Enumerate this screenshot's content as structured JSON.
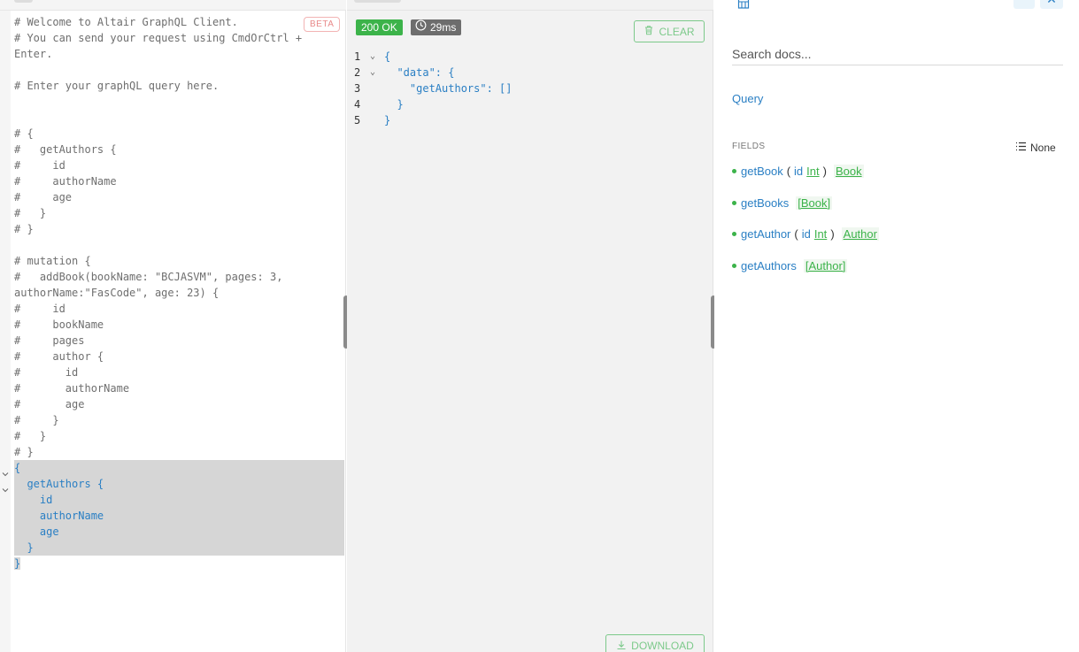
{
  "query_editor": {
    "beta_label": "BETA",
    "lines": [
      "# Welcome to Altair GraphQL Client.",
      "# You can send your request using CmdOrCtrl +",
      "Enter.",
      "",
      "# Enter your graphQL query here.",
      "",
      "",
      "# {",
      "#   getAuthors {",
      "#     id",
      "#     authorName",
      "#     age",
      "#   }",
      "# }",
      "",
      "# mutation {",
      "#   addBook(bookName: \"BCJASVM\", pages: 3,",
      "authorName:\"FasCode\", age: 23) {",
      "#     id",
      "#     bookName",
      "#     pages",
      "#     author {",
      "#       id",
      "#       authorName",
      "#       age",
      "#     }",
      "#   }",
      "# }",
      "{",
      "  getAuthors {",
      "    id",
      "    authorName",
      "    age",
      "  }",
      "}"
    ]
  },
  "result": {
    "status": "200 OK",
    "time": "29ms",
    "clear_label": "CLEAR",
    "download_label": "DOWNLOAD",
    "lines": [
      {
        "num": "1",
        "fold": "⌄",
        "text": "{"
      },
      {
        "num": "2",
        "fold": "⌄",
        "text": "  \"data\": {"
      },
      {
        "num": "3",
        "fold": "",
        "text": "    \"getAuthors\": []"
      },
      {
        "num": "4",
        "fold": "",
        "text": "  }"
      },
      {
        "num": "5",
        "fold": "",
        "text": "}"
      }
    ]
  },
  "docs": {
    "search_placeholder": "Search docs...",
    "more_label": "···",
    "close_label": "✕",
    "query_link": "Query",
    "fields_header": "FIELDS",
    "filter_label": "None",
    "fields": {
      "get_book": {
        "name": "getBook",
        "open": "(",
        "arg": "id",
        "arg_type": "Int",
        "close": ")",
        "type": "Book"
      },
      "get_books": {
        "name": "getBooks",
        "type": "[Book]"
      },
      "get_author": {
        "name": "getAuthor",
        "open": "(",
        "arg": "id",
        "arg_type": "Int",
        "close": ")",
        "type": "Author"
      },
      "get_authors": {
        "name": "getAuthors",
        "type": "[Author]"
      }
    }
  },
  "colors": {
    "accent_blue": "#2a7fc4",
    "success_green": "#3cb34a",
    "beta_red": "#e88a8a",
    "selection_gray": "#d6d6d6"
  }
}
